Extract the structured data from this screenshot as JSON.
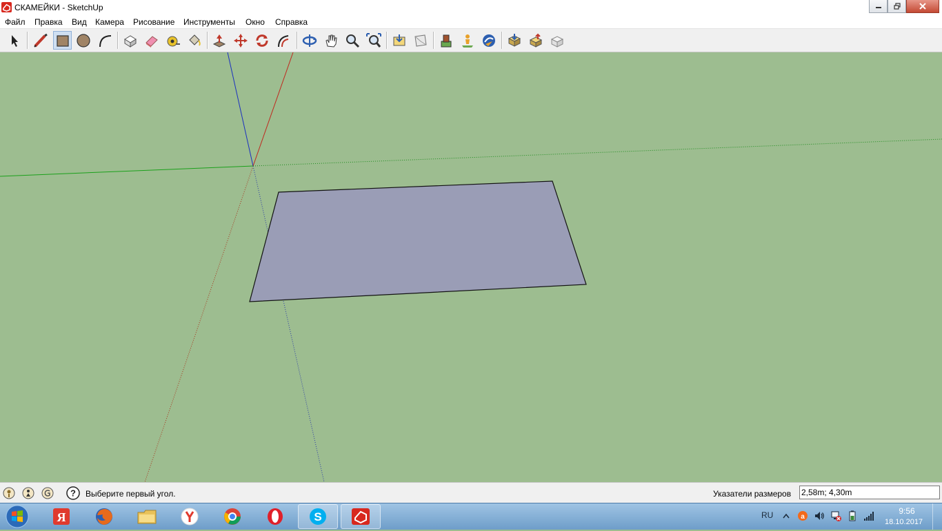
{
  "window": {
    "title": "СКАМЕЙКИ - SketchUp"
  },
  "menu": [
    "Файл",
    "Правка",
    "Вид",
    "Камера",
    "Рисование",
    "Инструменты",
    "Окно",
    "Справка"
  ],
  "toolbar": {
    "tools": [
      {
        "name": "select-tool-icon"
      },
      {
        "name": "line-tool-icon"
      },
      {
        "name": "rectangle-tool-icon"
      },
      {
        "name": "circle-tool-icon"
      },
      {
        "name": "arc-tool-icon"
      },
      {
        "name": "make-component-icon"
      },
      {
        "name": "eraser-icon"
      },
      {
        "name": "tape-measure-icon"
      },
      {
        "name": "paint-bucket-icon"
      },
      {
        "name": "push-pull-icon"
      },
      {
        "name": "move-icon"
      },
      {
        "name": "rotate-icon"
      },
      {
        "name": "offset-icon"
      },
      {
        "name": "orbit-icon"
      },
      {
        "name": "pan-icon"
      },
      {
        "name": "zoom-icon"
      },
      {
        "name": "zoom-extents-icon"
      },
      {
        "name": "get-models-icon"
      },
      {
        "name": "share-model-icon"
      },
      {
        "name": "component-warehouse-icon"
      },
      {
        "name": "add-location-icon"
      },
      {
        "name": "google-earth-icon"
      },
      {
        "name": "get-models-3d-icon"
      },
      {
        "name": "share-component-icon"
      },
      {
        "name": "extension-warehouse-icon"
      }
    ],
    "active": "rectangle-tool-icon"
  },
  "viewport": {
    "background": "#9dbd90",
    "face_color": "#9a9db6"
  },
  "status": {
    "message": "Выберите первый угол.",
    "measurements_label": "Указатели размеров",
    "measurements_value": "2,58m; 4,30m"
  },
  "taskbar": {
    "apps": [
      "yandex-app-icon",
      "firefox-icon",
      "file-explorer-icon",
      "yandex-browser-icon",
      "chrome-icon",
      "opera-icon",
      "skype-icon",
      "sketchup-icon"
    ],
    "language": "RU",
    "time": "9:56",
    "date": "18.10.2017"
  }
}
